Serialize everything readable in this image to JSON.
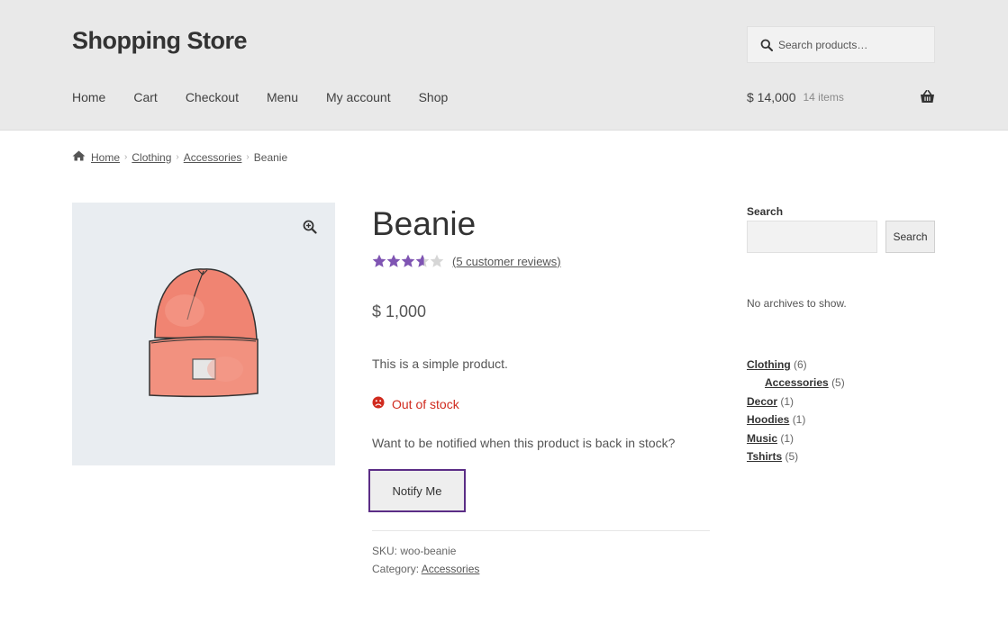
{
  "header": {
    "site_title": "Shopping Store",
    "search_placeholder": "Search products…",
    "nav": [
      "Home",
      "Cart",
      "Checkout",
      "Menu",
      "My account",
      "Shop"
    ],
    "cart_amount": "$ 14,000",
    "cart_count": "14 items"
  },
  "breadcrumb": {
    "items": [
      "Home",
      "Clothing",
      "Accessories"
    ],
    "current": "Beanie"
  },
  "product": {
    "title": "Beanie",
    "rating": 3.6,
    "rating_max": 5,
    "reviews_link": "(5 customer reviews)",
    "price": "$ 1,000",
    "description": "This is a simple product.",
    "stock_status": "Out of stock",
    "notify_prompt": "Want to be notified when this product is back in stock?",
    "notify_button": "Notify Me",
    "sku_label": "SKU:",
    "sku": "woo-beanie",
    "category_label": "Category:",
    "category": "Accessories"
  },
  "sidebar": {
    "search_label": "Search",
    "search_button": "Search",
    "archives_text": "No archives to show.",
    "categories": [
      {
        "name": "Clothing",
        "count": "(6)",
        "sub": false
      },
      {
        "name": "Accessories",
        "count": "(5)",
        "sub": true
      },
      {
        "name": "Decor",
        "count": "(1)",
        "sub": false
      },
      {
        "name": "Hoodies",
        "count": "(1)",
        "sub": false
      },
      {
        "name": "Music",
        "count": "(1)",
        "sub": false
      },
      {
        "name": "Tshirts",
        "count": "(5)",
        "sub": false
      }
    ]
  },
  "colors": {
    "accent": "#7f54b3",
    "focus_border": "#5b2d86",
    "out_of_stock": "#d02a1e",
    "header_bg": "#e9e9e9",
    "beanie": "#f0826f"
  }
}
